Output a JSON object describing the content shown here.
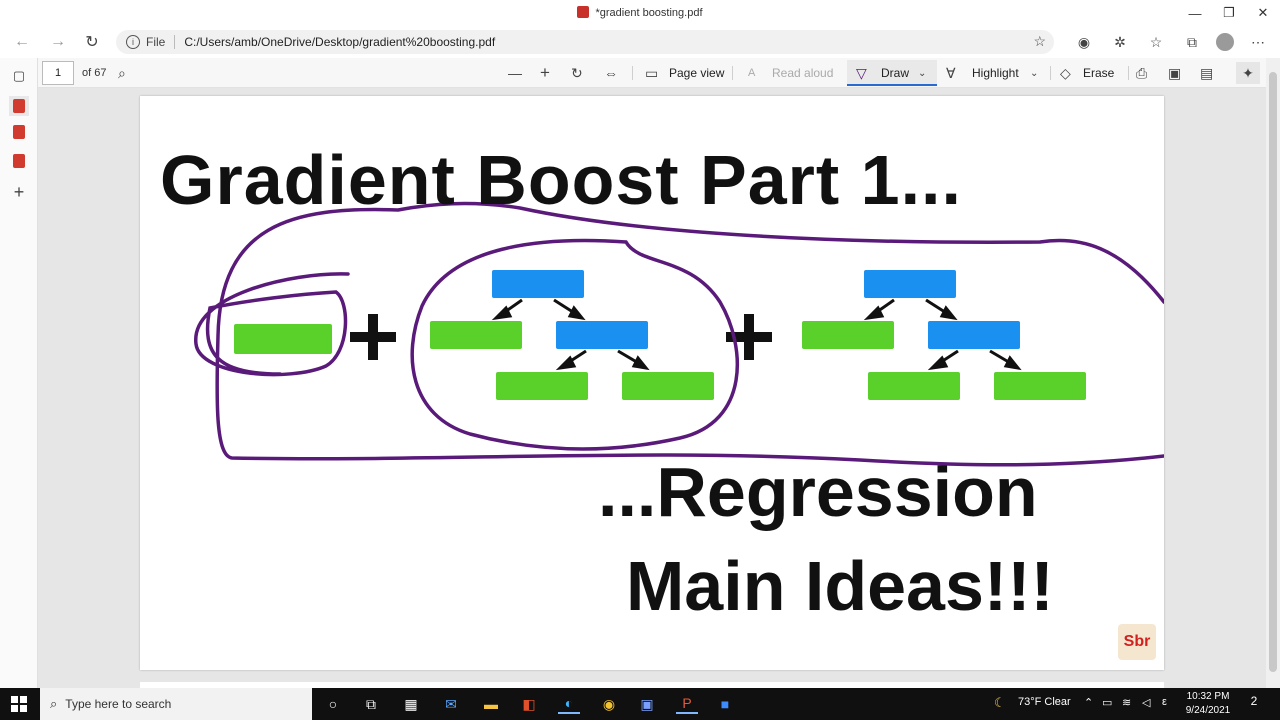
{
  "window": {
    "title": "*gradient boosting.pdf",
    "minimize_icon": "minimize-icon",
    "maximize_icon": "restore-icon",
    "close_icon": "close-icon"
  },
  "navbar": {
    "back_icon": "back-arrow-icon",
    "forward_icon": "forward-arrow-icon",
    "refresh_icon": "refresh-icon",
    "file_label": "File",
    "url": "C:/Users/amb/OneDrive/Desktop/gradient%20boosting.pdf"
  },
  "pdf_toolbar": {
    "page_number": "1",
    "page_count": "of 67",
    "page_view": "Page view",
    "read_aloud": "Read aloud",
    "draw": "Draw",
    "highlight": "Highlight",
    "erase": "Erase"
  },
  "document": {
    "heading": "Gradient Boost Part 1...",
    "subtitle_line1": "...Regression",
    "subtitle_line2": "Main Ideas!!!",
    "logo_text": "Sbr",
    "colors": {
      "leaf": "#5ad12b",
      "node": "#1a90f0",
      "ink": "#5a1a7a"
    }
  },
  "taskbar": {
    "search_placeholder": "Type here to search",
    "weather": "73°F  Clear",
    "language": "ε",
    "time": "10:32 PM",
    "date": "9/24/2021",
    "notifications": "2"
  }
}
